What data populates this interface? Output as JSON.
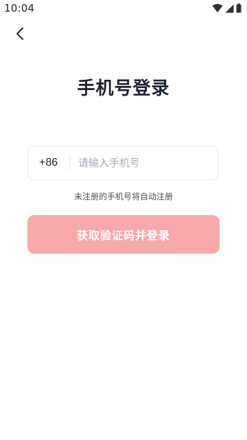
{
  "status_bar": {
    "time": "10:04",
    "icons": [
      "wifi-icon",
      "signal-icon",
      "battery-icon"
    ]
  },
  "header": {
    "back_icon": "chevron-left-icon"
  },
  "title": "手机号登录",
  "phone_field": {
    "country_code": "+86",
    "placeholder": "请输入手机号",
    "value": ""
  },
  "hint": "未注册的手机号将自动注册",
  "login_button": {
    "label": "获取验证码并登录",
    "enabled": false
  },
  "colors": {
    "button_bg": "#f7a1a1",
    "title_text": "#1d2233",
    "placeholder_text": "#a4a9b3",
    "field_border": "#e6e8ec"
  }
}
